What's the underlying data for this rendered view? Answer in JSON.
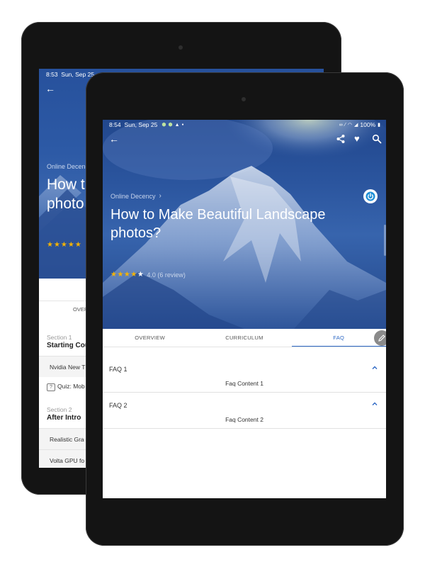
{
  "back_device": {
    "status": {
      "time": "8:53",
      "date": "Sun, Sep 25"
    },
    "breadcrumb": "Online Decenc",
    "title": "How t\nphoto",
    "stars": "★★★★★",
    "tab_overview": "OVER",
    "sections": [
      {
        "label": "Section 1",
        "title": "Starting Cou"
      },
      {
        "label": "Section 2",
        "title": "After Intro"
      }
    ],
    "items": [
      "Nvidia New T",
      "Realistic Gra",
      "Volta GPU fo"
    ],
    "quiz": "Quiz: Mob"
  },
  "status_bar": {
    "time": "8:54",
    "date": "Sun, Sep 25",
    "notification_icons": [
      "android-icon",
      "android-icon",
      "warning-icon",
      "dot-icon"
    ],
    "system_icons": [
      "link-icon",
      "no-sim-icon",
      "wifi-icon",
      "signal-icon",
      "battery-icon"
    ],
    "battery": "100%"
  },
  "toolbar": {
    "icons": [
      "back-arrow-icon",
      "share-icon",
      "heart-icon",
      "search-icon"
    ]
  },
  "course": {
    "breadcrumb": "Online Decency",
    "title": "How to Make Beautiful Landscape photos?",
    "rating_value": "4.0",
    "rating_count": "(6 review)",
    "stars_filled": 4,
    "stars_total": 5
  },
  "tabs": [
    {
      "label": "OVERVIEW",
      "active": false
    },
    {
      "label": "CURRICULUM",
      "active": false
    },
    {
      "label": "FAQ",
      "active": true
    }
  ],
  "faqs": [
    {
      "question": "FAQ 1",
      "answer": "Faq Content 1"
    },
    {
      "question": "FAQ 2",
      "answer": "Faq Content 2"
    }
  ],
  "colors": {
    "accent": "#2d68c4",
    "star": "#f5b301",
    "hero_blue": "#2b559e",
    "device": "#141414"
  }
}
